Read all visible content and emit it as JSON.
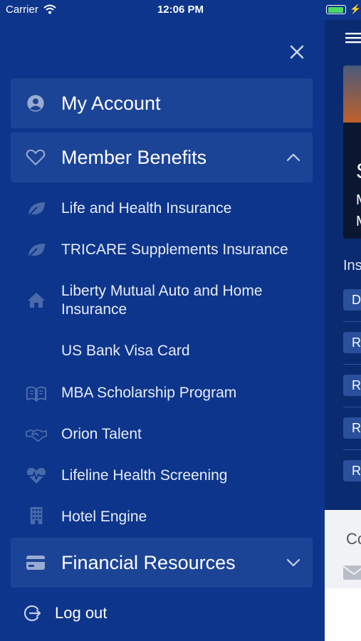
{
  "status_bar": {
    "carrier": "Carrier",
    "time": "12:06 PM",
    "battery_fill": 0.95
  },
  "menu": {
    "my_account": "My Account",
    "member_benefits": "Member Benefits",
    "financial_resources": "Financial Resources",
    "benefits": [
      {
        "label": "Life and Health Insurance",
        "icon": "leaf-icon"
      },
      {
        "label": "TRICARE Supplements Insurance",
        "icon": "leaf-icon"
      },
      {
        "label": "Liberty Mutual Auto and Home Insurance",
        "icon": "home-icon"
      },
      {
        "label": "US Bank Visa Card",
        "icon": ""
      },
      {
        "label": "MBA Scholarship Program",
        "icon": "book-icon"
      },
      {
        "label": "Orion Talent",
        "icon": "handshake-icon"
      },
      {
        "label": "Lifeline Health Screening",
        "icon": "heartbeat-icon"
      },
      {
        "label": "Hotel Engine",
        "icon": "building-icon"
      }
    ],
    "logout": "Log out"
  },
  "background_page": {
    "hero_big": "S",
    "hero_line1": "M",
    "hero_line2": "M",
    "section": "Ins",
    "pills": [
      "D",
      "Re",
      "Re",
      "Re",
      "Re"
    ],
    "card_text": "Co"
  },
  "colors": {
    "drawer_bg": "#0d358b",
    "row_bg": "#1c4496",
    "icon": "#8fa3cf"
  }
}
